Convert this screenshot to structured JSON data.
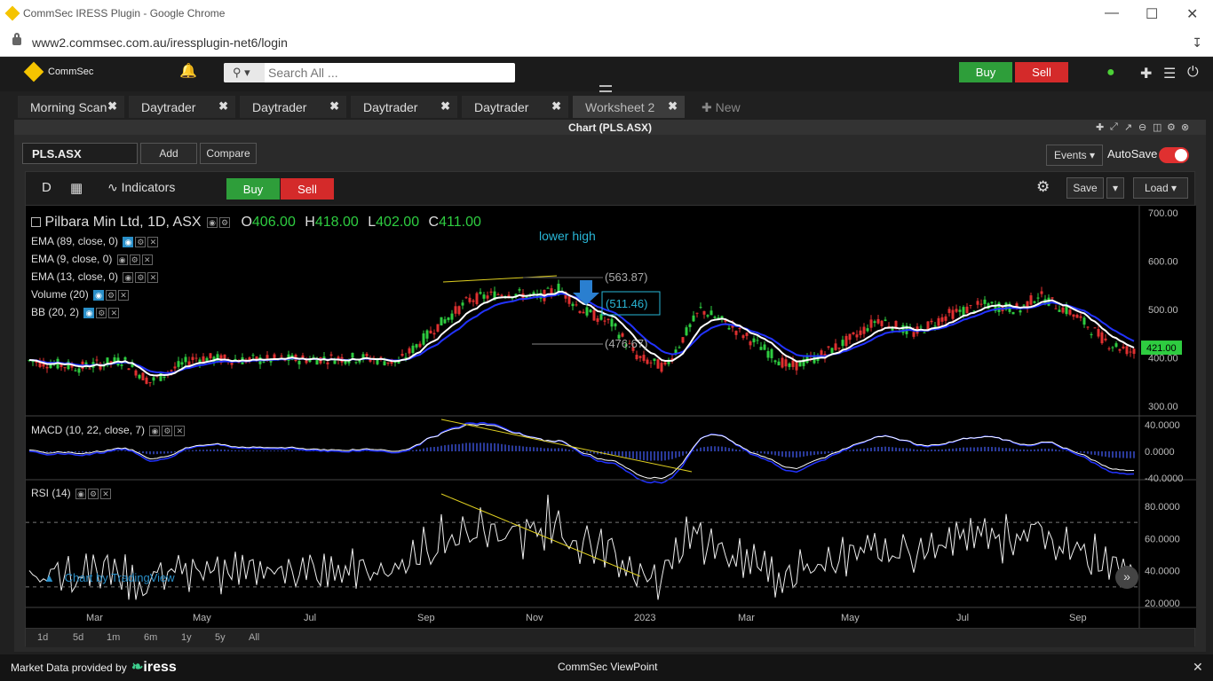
{
  "browser": {
    "title": "CommSec IRESS Plugin - Google Chrome",
    "url": "www2.commsec.com.au/iressplugin-net6/login"
  },
  "header": {
    "brand": "CommSec",
    "search_placeholder": "Search All ...",
    "buy_label": "Buy",
    "sell_label": "Sell"
  },
  "tabs": [
    {
      "label": "Morning Scan"
    },
    {
      "label": "Daytrader"
    },
    {
      "label": "Daytrader"
    },
    {
      "label": "Daytrader"
    },
    {
      "label": "Daytrader"
    },
    {
      "label": "Worksheet 2"
    }
  ],
  "new_tab_label": "New",
  "window": {
    "title": "Chart (PLS.ASX)",
    "symbol": "PLS.ASX",
    "add_label": "Add",
    "compare_label": "Compare",
    "events_label": "Events",
    "autosave_label": "AutoSave"
  },
  "toolbar": {
    "interval": "D",
    "indicators_label": "Indicators",
    "buy_label": "Buy",
    "sell_label": "Sell",
    "save_label": "Save",
    "load_label": "Load"
  },
  "legend": {
    "title": "Pilbara Min Ltd, 1D, ASX",
    "o_label": "O",
    "o_value": "406.00",
    "h_label": "H",
    "h_value": "418.00",
    "l_label": "L",
    "l_value": "402.00",
    "c_label": "C",
    "c_value": "411.00",
    "indicators": [
      "EMA (89, close, 0)",
      "EMA (9, close, 0)",
      "EMA (13, close, 0)",
      "Volume (20)",
      "BB (20, 2)"
    ],
    "macd": "MACD (10, 22, close, 7)",
    "rsi": "RSI (14)",
    "watermark": "Chart by TradingView"
  },
  "annotations": {
    "lower_high": "lower high",
    "level1": "(563.87)",
    "level2": "(511.46)",
    "level3": "(476.67)"
  },
  "price_axis": [
    "700.00",
    "600.00",
    "500.00",
    "400.00",
    "300.00"
  ],
  "last_price": "421.00",
  "macd_axis": [
    "40.0000",
    "0.0000",
    "-40.0000"
  ],
  "rsi_axis": [
    "80.0000",
    "60.0000",
    "40.0000",
    "20.0000"
  ],
  "time_axis": [
    "Mar",
    "May",
    "Jul",
    "Sep",
    "Nov",
    "2023",
    "Mar",
    "May",
    "Jul",
    "Sep"
  ],
  "timeframes": [
    "1d",
    "5d",
    "1m",
    "6m",
    "1y",
    "5y",
    "All"
  ],
  "footer": {
    "provider": "Market Data provided by",
    "provider_brand": "iress",
    "center": "CommSec ViewPoint"
  },
  "colors": {
    "up": "#2ecc40",
    "down": "#e03030",
    "ema_fast": "#ffffff",
    "ema_slow": "#2233ff",
    "trend": "#e0d020",
    "annot": "#29b6d6"
  }
}
